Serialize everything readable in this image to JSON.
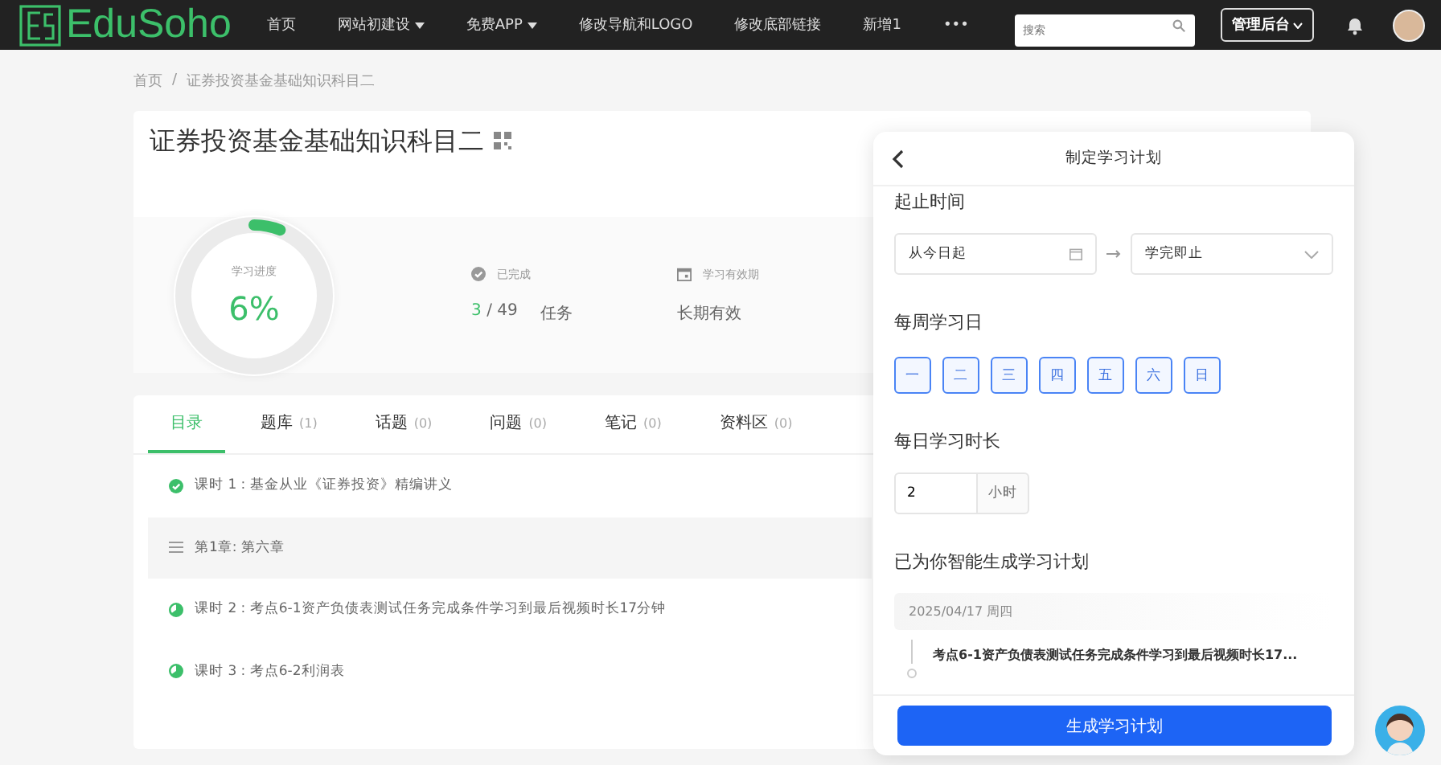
{
  "header": {
    "logo": "EduSoho",
    "nav": [
      {
        "label": "首页",
        "dropdown": false
      },
      {
        "label": "网站初建设",
        "dropdown": true
      },
      {
        "label": "免费APP",
        "dropdown": true
      },
      {
        "label": "修改导航和LOGO",
        "dropdown": false
      },
      {
        "label": "修改底部链接",
        "dropdown": false
      },
      {
        "label": "新增1",
        "dropdown": false
      },
      {
        "label": "•••",
        "dropdown": false
      }
    ],
    "search": {
      "placeholder": "搜索"
    },
    "admin_button": "管理后台"
  },
  "breadcrumb": {
    "items": [
      "首页",
      "证券投资基金基础知识科目二"
    ],
    "separator": "/"
  },
  "course": {
    "title": "证券投资基金基础知识科目二",
    "progress": {
      "label": "学习进度",
      "value": "6%",
      "level": 0.06
    },
    "completed": {
      "label": "已完成",
      "done": "3",
      "total": "/ 49",
      "unit": "任务"
    },
    "validity": {
      "label": "学习有效期",
      "value": "长期有效"
    }
  },
  "tabs": [
    {
      "label": "目录",
      "selected": true
    },
    {
      "label": "题库",
      "count": "(1)",
      "selected": false
    },
    {
      "label": "话题",
      "count": "(0)",
      "selected": false
    },
    {
      "label": "问题",
      "count": "(0)",
      "selected": false
    },
    {
      "label": "笔记",
      "count": "(0)",
      "selected": false
    },
    {
      "label": "资料区",
      "count": "(0)",
      "selected": false
    }
  ],
  "lessons": [
    {
      "kind": "done",
      "text": "课时 1 : 基金从业《证券投资》精编讲义"
    },
    {
      "kind": "chapter",
      "text": "第1章: 第六章"
    },
    {
      "kind": "partial",
      "text": "课时 2 : 考点6-1资产负债表测试任务完成条件学习到最后视频时长17分钟"
    },
    {
      "kind": "partial",
      "text": "课时 3 : 考点6-2利润表"
    }
  ],
  "plan_panel": {
    "title": "制定学习计划",
    "period": {
      "heading": "起止时间",
      "start": "从今日起",
      "end": "学完即止"
    },
    "weekdays": {
      "heading": "每周学习日",
      "days": [
        {
          "label": "一",
          "selected": true
        },
        {
          "label": "二",
          "selected": true
        },
        {
          "label": "三",
          "selected": true
        },
        {
          "label": "四",
          "selected": true
        },
        {
          "label": "五",
          "selected": true
        },
        {
          "label": "六",
          "selected": true
        },
        {
          "label": "日",
          "selected": true
        }
      ]
    },
    "daily": {
      "heading": "每日学习时长",
      "value": "2",
      "unit": "小时"
    },
    "generated": {
      "heading": "已为你智能生成学习计划",
      "date": "2025/04/17 周四",
      "item": "考点6-1资产负债表测试任务完成条件学习到最后视频时长17..."
    },
    "button": "生成学习计划"
  }
}
